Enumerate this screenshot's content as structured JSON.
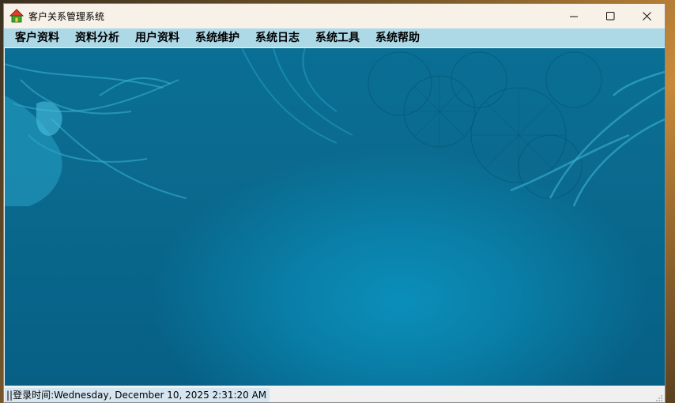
{
  "window": {
    "title": "客户关系管理系统",
    "icon": "house-icon",
    "controls": {
      "minimize": "—",
      "maximize": "☐",
      "close": "✕"
    }
  },
  "menu": {
    "items": [
      {
        "label": "客户资料"
      },
      {
        "label": "资料分析"
      },
      {
        "label": "用户资料"
      },
      {
        "label": "系统维护"
      },
      {
        "label": "系统日志"
      },
      {
        "label": "系统工具"
      },
      {
        "label": "系统帮助"
      }
    ]
  },
  "statusbar": {
    "login_time": "||登录时间:Wednesday, December 10, 2025 2:31:20 AM"
  },
  "colors": {
    "menubar": "#add8e6",
    "background": "#0a6f95",
    "titlebar": "#f7f1e8"
  }
}
